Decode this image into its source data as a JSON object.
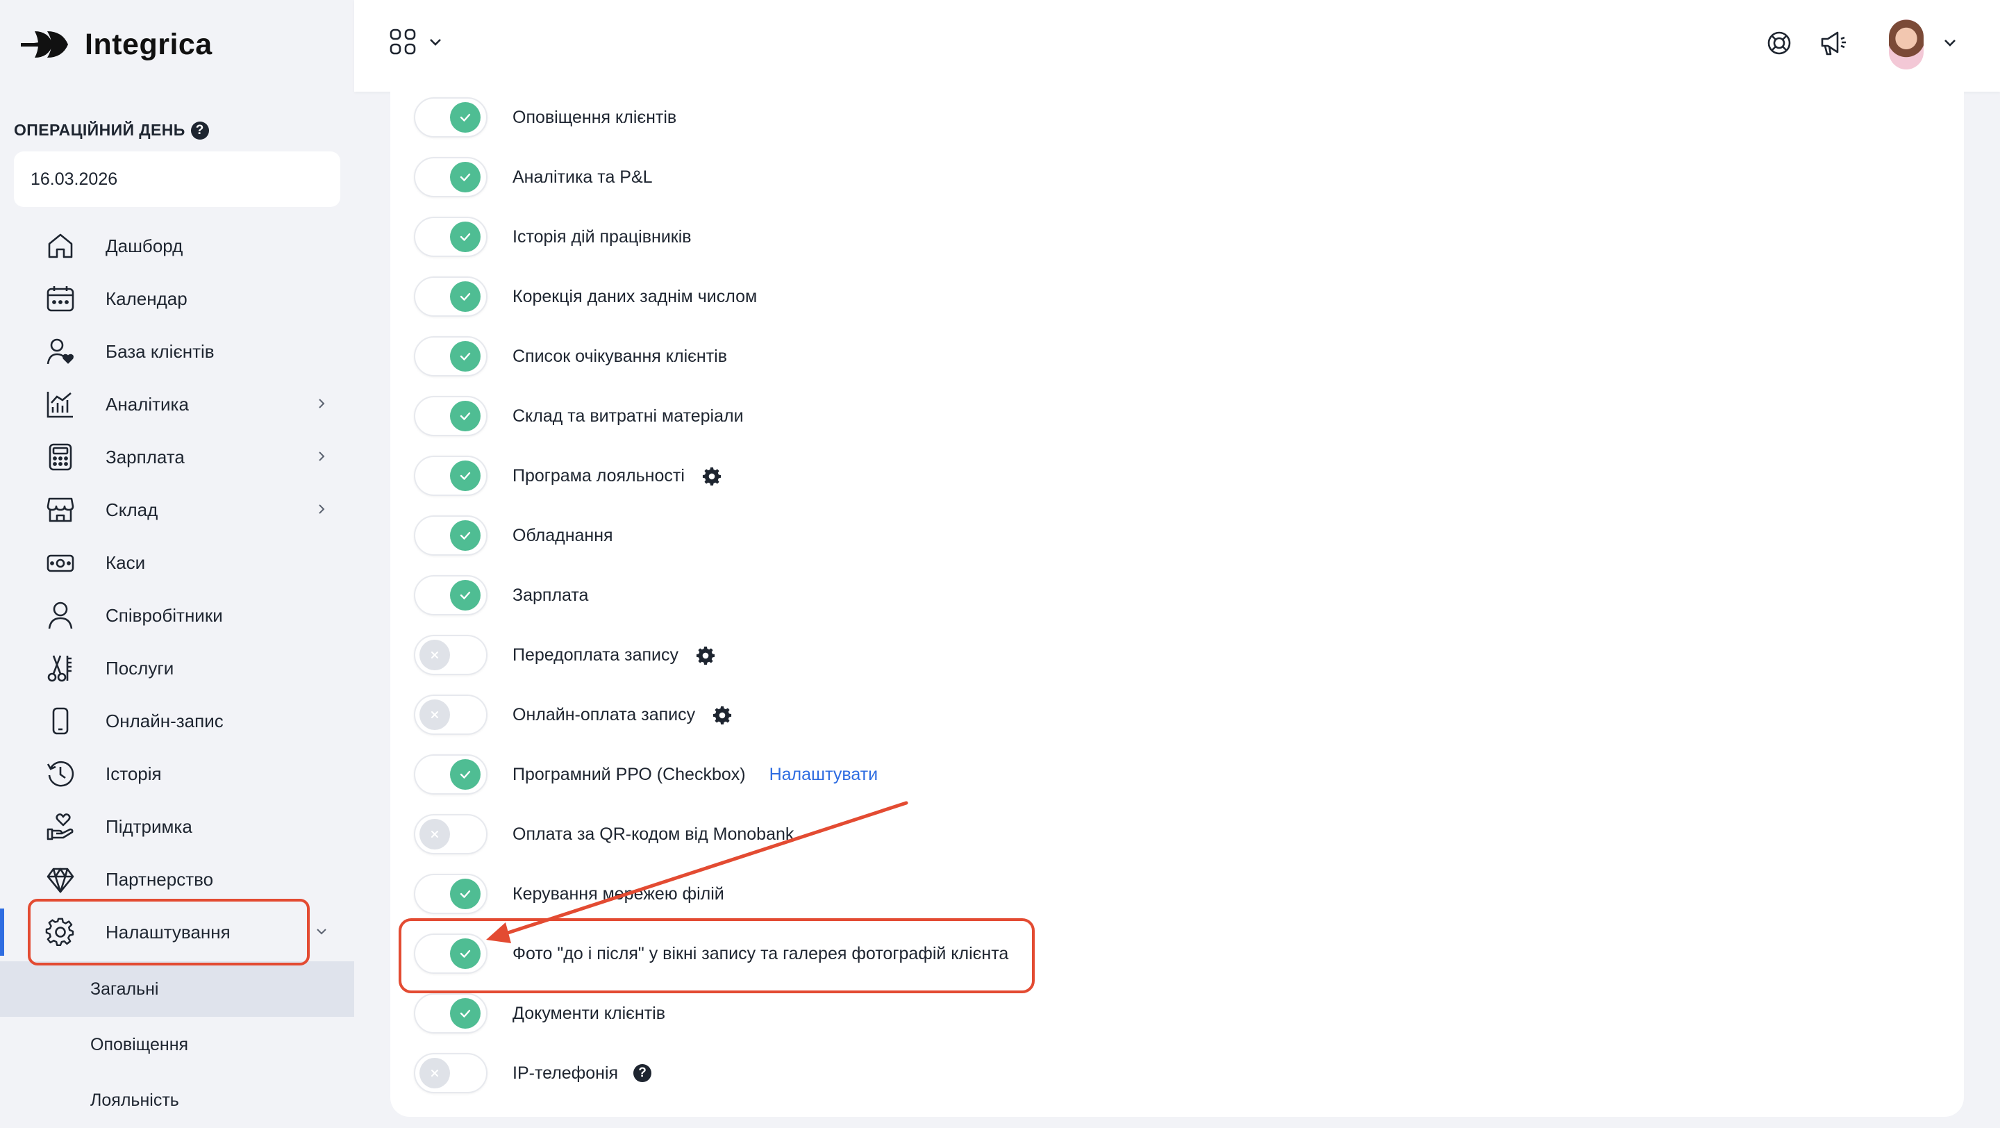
{
  "brand": {
    "name": "Integrica"
  },
  "sidebar": {
    "op_day_label": "ОПЕРАЦІЙНИЙ ДЕНЬ",
    "help_glyph": "?",
    "date_value": "16.03.2026",
    "items": [
      {
        "label": "Дашборд",
        "icon": "home-icon"
      },
      {
        "label": "Календар",
        "icon": "calendar-icon"
      },
      {
        "label": "База клієнтів",
        "icon": "clients-icon"
      },
      {
        "label": "Аналітика",
        "icon": "analytics-icon",
        "has_submenu": true
      },
      {
        "label": "Зарплата",
        "icon": "calculator-icon",
        "has_submenu": true
      },
      {
        "label": "Склад",
        "icon": "store-icon",
        "has_submenu": true
      },
      {
        "label": "Каси",
        "icon": "cash-icon"
      },
      {
        "label": "Співробітники",
        "icon": "person-icon"
      },
      {
        "label": "Послуги",
        "icon": "scissors-icon"
      },
      {
        "label": "Онлайн-запис",
        "icon": "phone-icon"
      },
      {
        "label": "Історія",
        "icon": "history-icon"
      },
      {
        "label": "Підтримка",
        "icon": "support-icon"
      },
      {
        "label": "Партнерство",
        "icon": "diamond-icon"
      },
      {
        "label": "Налаштування",
        "icon": "gear-icon",
        "expanded": true,
        "active": true
      }
    ],
    "subitems": [
      {
        "label": "Загальні",
        "selected": true
      },
      {
        "label": "Оповіщення"
      },
      {
        "label": "Лояльність"
      }
    ]
  },
  "topbar": {
    "apps_icon": "apps-grid-icon",
    "icons": [
      "support-bubble-icon",
      "megaphone-icon"
    ],
    "avatar": "user-avatar"
  },
  "settings": {
    "rows": [
      {
        "label": "Оповіщення клієнтів",
        "on": true
      },
      {
        "label": "Аналітика та P&L",
        "on": true
      },
      {
        "label": "Історія дій працівників",
        "on": true
      },
      {
        "label": "Корекція даних заднім числом",
        "on": true
      },
      {
        "label": "Список очікування клієнтів",
        "on": true
      },
      {
        "label": "Склад та витратні матеріали",
        "on": true
      },
      {
        "label": "Програма лояльності",
        "on": true,
        "gear": true
      },
      {
        "label": "Обладнання",
        "on": true
      },
      {
        "label": "Зарплата",
        "on": true
      },
      {
        "label": "Передоплата запису",
        "on": false,
        "gear": true
      },
      {
        "label": "Онлайн-оплата запису",
        "on": false,
        "gear": true
      },
      {
        "label": "Програмний РРО (Checkbox)",
        "on": true,
        "link": "Налаштувати"
      },
      {
        "label": "Оплата за QR-кодом від Monobank",
        "on": false
      },
      {
        "label": "Керування мережею філій",
        "on": true
      },
      {
        "label": "Фото \"до і після\" у вікні запису та галерея фотографій клієнта",
        "on": true,
        "highlighted": true
      },
      {
        "label": "Документи клієнтів",
        "on": true
      },
      {
        "label": "IP-телефонія",
        "on": false,
        "help": true
      }
    ]
  },
  "colors": {
    "accent": "#2f6de1",
    "toggle_on": "#4fbd93",
    "toggle_off": "#dfe2e8",
    "annotation": "#e34b32"
  }
}
